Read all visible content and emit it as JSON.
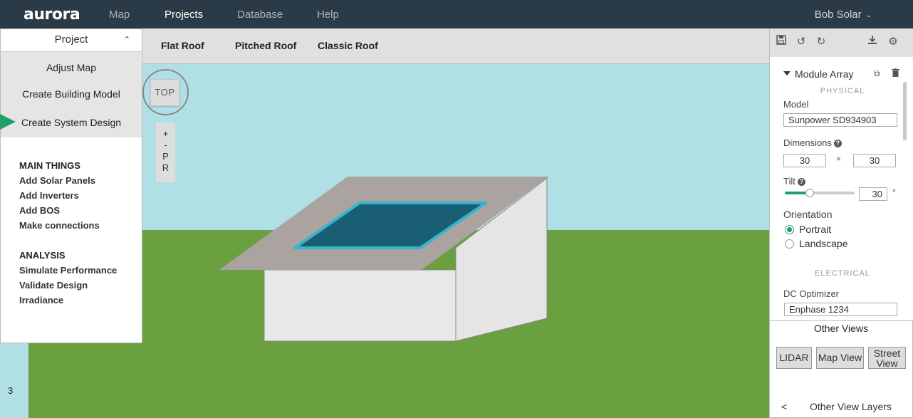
{
  "topbar": {
    "logo": "aurora",
    "nav": [
      "Map",
      "Projects",
      "Database",
      "Help"
    ],
    "active_nav": "Projects",
    "user": "Bob Solar"
  },
  "left_panel": {
    "header": "Project",
    "steps": [
      "Adjust Map",
      "Create Building Model",
      "Create System Design"
    ],
    "active_step": "Create System Design",
    "main_title": "MAIN THINGS",
    "main_items": [
      "Add Solar Panels",
      "Add Inverters",
      "Add BOS",
      "Make connections"
    ],
    "analysis_title": "ANALYSIS",
    "analysis_items": [
      "Simulate Performance",
      "Validate Design",
      "Irradiance"
    ]
  },
  "roof_tabs": [
    "Flat Roof",
    "Pitched Roof",
    "Classic Roof"
  ],
  "viewport": {
    "top_button": "TOP",
    "zoom_controls": [
      "+",
      "-",
      "P",
      "R"
    ],
    "page_number": "3"
  },
  "properties": {
    "title": "Module Array",
    "physical_label": "PHYSICAL",
    "model_label": "Model",
    "model_value": "Sunpower SD934903",
    "dimensions_label": "Dimensions",
    "dim_x": "30",
    "dim_y": "30",
    "times": "×",
    "tilt_label": "Tilt",
    "tilt_value": "30",
    "tilt_fraction": 0.3,
    "degree": "°",
    "orientation_label": "Orientation",
    "orientation_options": [
      "Portrait",
      "Landscape"
    ],
    "orientation_selected": "Portrait",
    "electrical_label": "ELECTRICAL",
    "optimizer_label": "DC Optimizer",
    "optimizer_value": "Enphase 1234"
  },
  "other_views": {
    "title": "Other Views",
    "buttons": [
      "LIDAR",
      "Map View",
      "Street View"
    ],
    "layers_toggle": "<",
    "layers_label": "Other View Layers"
  },
  "colors": {
    "accent": "#1fa06b",
    "topbar": "#2a3a46",
    "sky": "#b0dfe6",
    "ground": "#6ba040",
    "roof": "#aba39f",
    "panel": "#1a5e73",
    "panel_border": "#35b4cc"
  }
}
